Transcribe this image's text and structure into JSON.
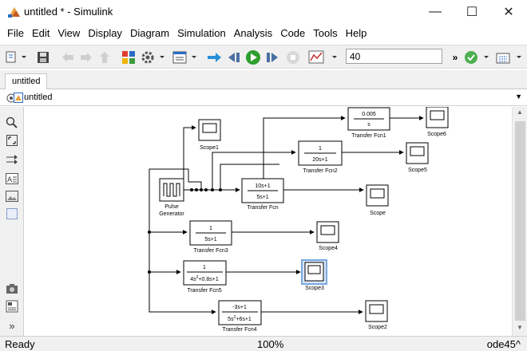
{
  "window": {
    "title": "untitled * - Simulink"
  },
  "menu": [
    "File",
    "Edit",
    "View",
    "Display",
    "Diagram",
    "Simulation",
    "Analysis",
    "Code",
    "Tools",
    "Help"
  ],
  "toolbar": {
    "stop_time": "40"
  },
  "tab": {
    "label": "untitled"
  },
  "address": {
    "path": "untitled"
  },
  "blocks": {
    "pulse": {
      "label1": "Pulse",
      "label2": "Generator"
    },
    "tf": {
      "num": "10s+1",
      "den": "5s+1",
      "label": "Transfer Fcn"
    },
    "tf1": {
      "num": "0.005",
      "den": "s",
      "label": "Transfer Fcn1"
    },
    "tf2": {
      "num": "1",
      "den": "20s+1",
      "label": "Transfer Fcn2"
    },
    "tf3": {
      "num": "1",
      "den": "5s+1",
      "label": "Transfer Fcn3"
    },
    "tf4": {
      "num": "-3s+1",
      "den_a": "5s",
      "den_sup": "2",
      "den_b": "+6s+1",
      "label": "Transfer Fcn4"
    },
    "tf5": {
      "num": "1",
      "den_a": "4s",
      "den_sup": "2",
      "den_b": "+0.8s+1",
      "label": "Transfer Fcn5"
    },
    "scope": "Scope",
    "scope1": "Scope1",
    "scope2": "Scope2",
    "scope3": "Scope3",
    "scope4": "Scope4",
    "scope5": "Scope5",
    "scope6": "Scope6"
  },
  "status": {
    "left": "Ready",
    "zoom": "100%",
    "solver": "ode45"
  },
  "colors": {
    "signal": "#000000",
    "selected": "#7aa7e0",
    "run_green": "#2e9e2e",
    "toolbar_bg": "#f0f0f0"
  }
}
